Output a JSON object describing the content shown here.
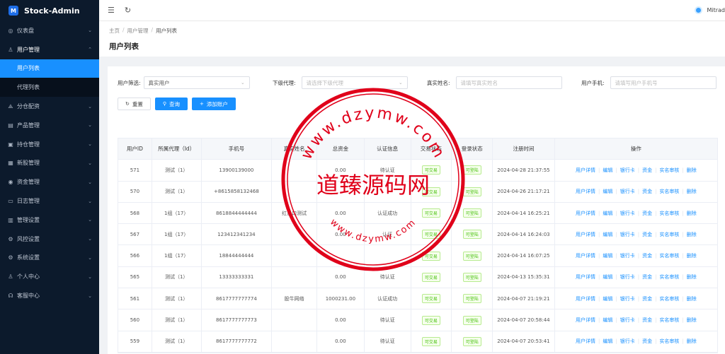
{
  "app": {
    "title": "Stock-Admin",
    "logo_text": "M"
  },
  "sidebar": {
    "items": [
      {
        "label": "仪表盘",
        "icon": "dashboard-icon"
      },
      {
        "label": "用户管理",
        "icon": "user-group-icon",
        "open": true,
        "children": [
          {
            "label": "用户列表",
            "active": true
          },
          {
            "label": "代理列表"
          }
        ]
      },
      {
        "label": "分仓配资",
        "icon": "split-icon"
      },
      {
        "label": "产品管理",
        "icon": "chart-icon"
      },
      {
        "label": "持仓管理",
        "icon": "position-icon"
      },
      {
        "label": "新股管理",
        "icon": "new-stock-icon"
      },
      {
        "label": "资金管理",
        "icon": "money-icon"
      },
      {
        "label": "日志管理",
        "icon": "log-icon"
      },
      {
        "label": "管理设置",
        "icon": "admin-settings-icon"
      },
      {
        "label": "风控设置",
        "icon": "risk-icon"
      },
      {
        "label": "系统设置",
        "icon": "settings-icon"
      },
      {
        "label": "个人中心",
        "icon": "person-icon"
      },
      {
        "label": "客服中心",
        "icon": "headset-icon"
      }
    ]
  },
  "header": {
    "username": "Mitrad"
  },
  "breadcrumb": [
    "主页",
    "用户管理",
    "用户列表"
  ],
  "page_title": "用户列表",
  "filters": {
    "user_filter_label": "用户筛选:",
    "user_filter_value": "真实用户",
    "agent_label": "下级代理:",
    "agent_placeholder": "请选择下级代理",
    "realname_label": "真实姓名:",
    "realname_placeholder": "请填写真实姓名",
    "phone_label": "用户手机:",
    "phone_placeholder": "请填写用户手机号",
    "reset": "重置",
    "search": "查询",
    "add": "添加账户"
  },
  "table": {
    "headers": [
      "用户ID",
      "所属代理（Id）",
      "手机号",
      "真实姓名",
      "总资金",
      "认证信息",
      "交易状态",
      "登录状态",
      "注册时间",
      "操作"
    ],
    "actions": [
      "用户详情",
      "编辑",
      "银行卡",
      "资金",
      "实名审核",
      "删除"
    ],
    "rows": [
      [
        "571",
        "测试（1）",
        "13900139000",
        "",
        "0.00",
        "待认证",
        "可交易",
        "可登陆",
        "2024-04-28 21:37:55"
      ],
      [
        "570",
        "测试（1）",
        "+8615858132468",
        "",
        "",
        "",
        "可交易",
        "可登陆",
        "2024-04-26 21:17:21"
      ],
      [
        "568",
        "1组（17）",
        "8618844444444",
        "红日口测试",
        "0.00",
        "认证成功",
        "可交易",
        "可登陆",
        "2024-04-14 16:25:21"
      ],
      [
        "567",
        "1组（17）",
        "123412341234",
        "",
        "0.00",
        "认证",
        "可交易",
        "可登陆",
        "2024-04-14 16:24:03"
      ],
      [
        "566",
        "1组（17）",
        "18844444444",
        "",
        "",
        "",
        "可交易",
        "可登陆",
        "2024-04-14 16:07:25"
      ],
      [
        "565",
        "测试（1）",
        "13333333331",
        "",
        "0.00",
        "待认证",
        "可交易",
        "可登陆",
        "2024-04-13 15:35:31"
      ],
      [
        "561",
        "测试（1）",
        "8617777777774",
        "股牛网络",
        "1000231.00",
        "认证成功",
        "可交易",
        "可登陆",
        "2024-04-07 21:19:21"
      ],
      [
        "560",
        "测试（1）",
        "8617777777773",
        "",
        "0.00",
        "待认证",
        "可交易",
        "可登陆",
        "2024-04-07 20:58:44"
      ],
      [
        "559",
        "测试（1）",
        "8617777777772",
        "",
        "0.00",
        "待认证",
        "可交易",
        "可登陆",
        "2024-04-07 20:53:41"
      ]
    ]
  },
  "watermark": {
    "main": "道臻源码网",
    "top": "www.dzymw.com",
    "bottom": "www.dzymw.com",
    "color": "#e0001a"
  }
}
